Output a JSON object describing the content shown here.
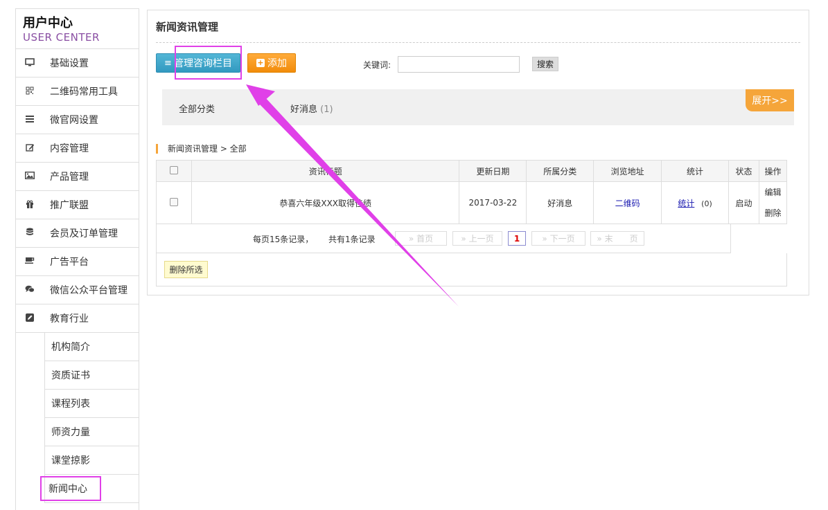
{
  "brand": {
    "title": "用户中心",
    "subtitle": "USER CENTER"
  },
  "sidebar": {
    "items": [
      {
        "label": "基础设置",
        "icon": "monitor-icon"
      },
      {
        "label": "二维码常用工具",
        "icon": "qrcode-icon"
      },
      {
        "label": "微官网设置",
        "icon": "list-icon"
      },
      {
        "label": "内容管理",
        "icon": "edit-icon"
      },
      {
        "label": "产品管理",
        "icon": "image-icon"
      },
      {
        "label": "推广联盟",
        "icon": "gift-icon"
      },
      {
        "label": "会员及订单管理",
        "icon": "database-icon"
      },
      {
        "label": "广告平台",
        "icon": "coffee-icon"
      },
      {
        "label": "微信公众平台管理",
        "icon": "chat-icon"
      },
      {
        "label": "教育行业",
        "icon": "pencil-square-icon"
      }
    ],
    "sub_items": [
      {
        "label": "机构简介"
      },
      {
        "label": "资质证书"
      },
      {
        "label": "课程列表"
      },
      {
        "label": "师资力量"
      },
      {
        "label": "课堂掠影"
      },
      {
        "label": "新闻中心"
      }
    ]
  },
  "main": {
    "title": "新闻资讯管理",
    "manage_button": "管理咨询栏目",
    "add_button": "添加",
    "keyword_label": "关键词:",
    "keyword_value": "",
    "search_button": "搜索",
    "categories": {
      "all": "全部分类",
      "news": "好消息",
      "news_count": "(1)",
      "expand": "展开>>"
    },
    "breadcrumb": "新闻资讯管理 > 全部",
    "table": {
      "headers": [
        "资讯标题",
        "更新日期",
        "所属分类",
        "浏览地址",
        "统计",
        "状态",
        "操作"
      ],
      "rows": [
        {
          "title": "恭喜六年级XXX取得佳绩",
          "date": "2017-03-22",
          "category": "好消息",
          "url": "二维码",
          "stats_link": "统计",
          "stats_count": "(0)",
          "status": "启动",
          "edit": "编辑",
          "delete": "删除"
        }
      ]
    },
    "pager": {
      "per_page": "每页15条记录，",
      "total": "共有1条记录",
      "first": "» 首页",
      "prev": "» 上一页",
      "current": "1",
      "next": "» 下一页",
      "last": "» 末　　页"
    },
    "delete_selected": "删除所选"
  },
  "colors": {
    "highlight": "#e040e8",
    "manage_btn": "#3aa3c9",
    "add_btn": "#f5961a",
    "brand_sub": "#8a4fa3"
  }
}
